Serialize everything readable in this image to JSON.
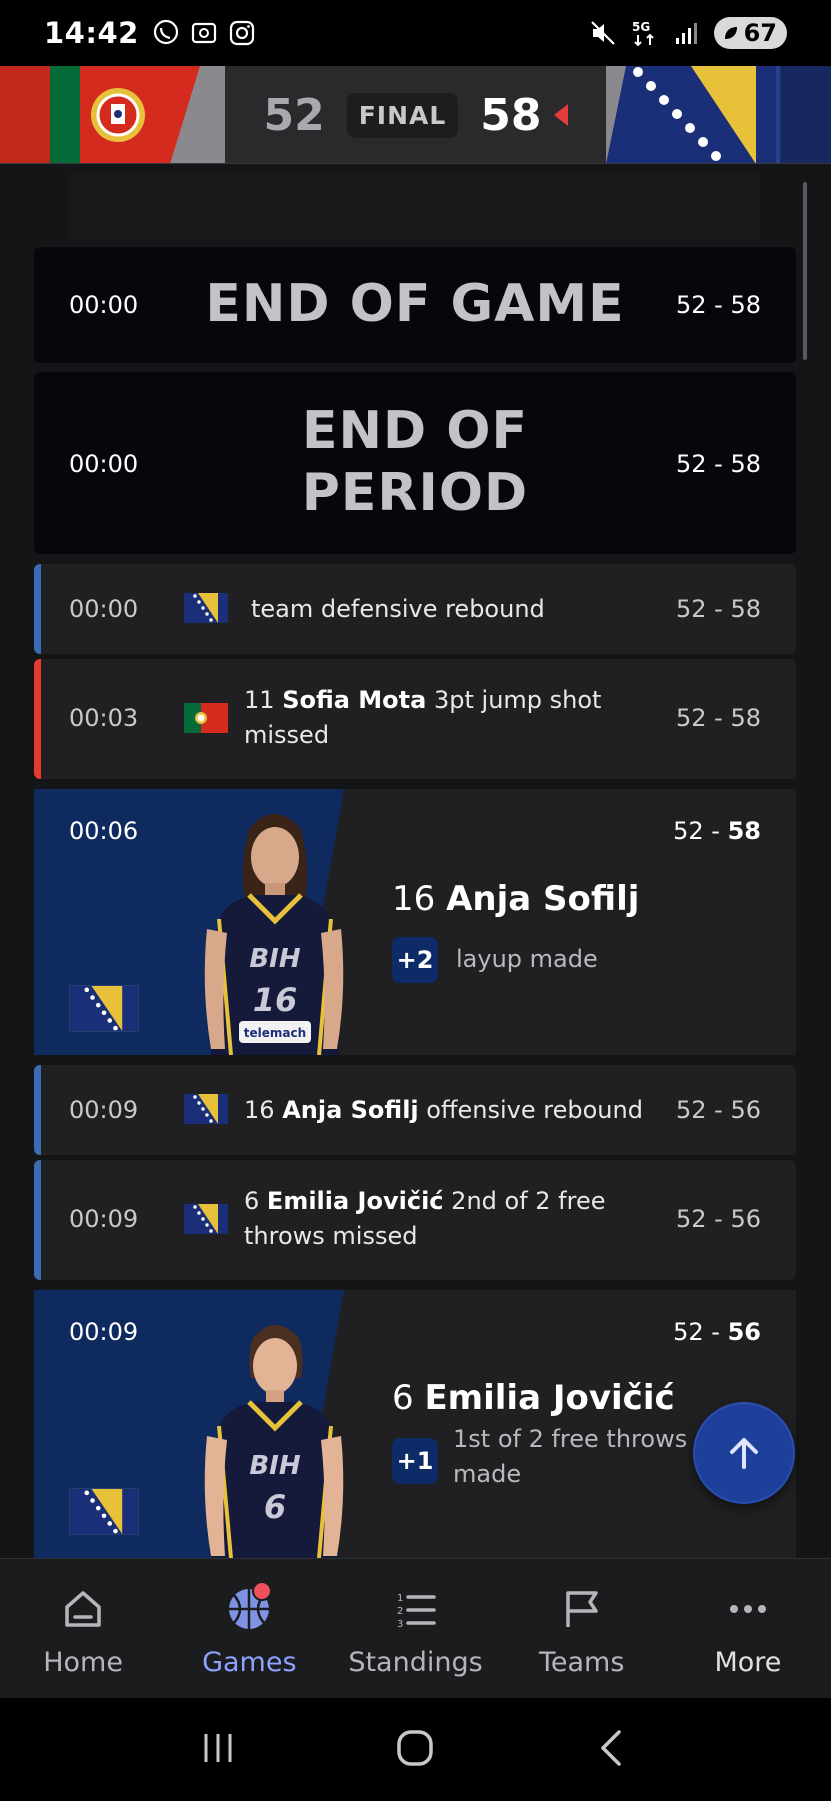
{
  "status_bar": {
    "time": "14:42",
    "battery": "67"
  },
  "score": {
    "away_score": "52",
    "status": "FINAL",
    "home_score": "58",
    "colors": {
      "portugal_red": "#d52b1e",
      "portugal_green": "#046a38",
      "bosnia_blue": "#1b2f78",
      "bosnia_yellow": "#e8c13a"
    }
  },
  "feed": {
    "end_game": {
      "time": "00:00",
      "title": "END OF GAME",
      "score": "52 - 58"
    },
    "end_period": {
      "time": "00:00",
      "title_line1": "END OF",
      "title_line2": "PERIOD",
      "score": "52 - 58"
    },
    "plays": [
      {
        "time": "00:00",
        "text": "team defensive rebound",
        "score": "52 - 58"
      },
      {
        "time": "00:03",
        "number": "11",
        "player": "Sofia Mota",
        "line1_rest": "3pt jump shot",
        "line2": "missed",
        "score": "52 - 58"
      },
      {
        "time": "00:09",
        "number": "16",
        "player": "Anja Sofilj",
        "rest": "offensive rebound",
        "score": "52 - 56"
      },
      {
        "time": "00:09",
        "number": "6",
        "player": "Emilia Jovičić",
        "line1_rest": "2nd of 2 free",
        "line2": "throws missed",
        "score": "52 - 56"
      }
    ],
    "featured": [
      {
        "time": "00:06",
        "score_left": "52 - ",
        "score_bold": "58",
        "number": "16",
        "player": "Anja Sofilj",
        "points": "+2",
        "desc": "layup made",
        "jersey_text": "BIH",
        "jersey_number": "16",
        "sponsor": "telemach"
      },
      {
        "time": "00:09",
        "score_left": "52 - ",
        "score_bold": "56",
        "number": "6",
        "player": "Emilia Jovičić",
        "points": "+1",
        "desc_line1": "1st of 2 free throws",
        "desc_line2": "made",
        "jersey_text": "BIH",
        "jersey_number": "6"
      }
    ]
  },
  "bottom_nav": [
    {
      "label": "Home",
      "icon": "home-icon"
    },
    {
      "label": "Games",
      "icon": "basketball-icon",
      "active": true
    },
    {
      "label": "Standings",
      "icon": "list-icon"
    },
    {
      "label": "Teams",
      "icon": "flag-icon"
    },
    {
      "label": "More",
      "icon": "more-icon"
    }
  ]
}
